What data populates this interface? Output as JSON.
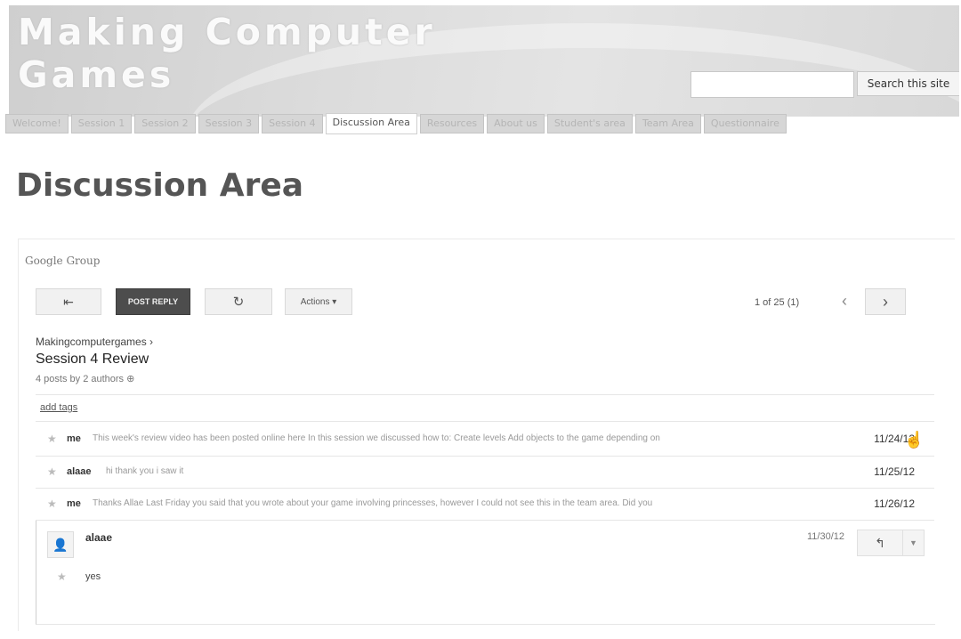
{
  "site": {
    "title_line1": "Making Computer",
    "title_line2": "Games",
    "search_button": "Search this site",
    "search_value": ""
  },
  "nav": {
    "tabs": [
      "Welcome!",
      "Session 1",
      "Session 2",
      "Session 3",
      "Session 4",
      "Discussion Area",
      "Resources",
      "About us",
      "Student's area",
      "Team Area",
      "Questionnaire"
    ],
    "active": "Discussion Area"
  },
  "page": {
    "title": "Discussion Area"
  },
  "group": {
    "label": "Google Group",
    "toolbar": {
      "back_icon": "back-arrow-icon",
      "post_reply": "POST REPLY",
      "refresh_icon": "refresh-icon",
      "actions": "Actions ▾",
      "pager": "1 of 25 (1)",
      "prev_icon": "chevron-left-icon",
      "next_icon": "chevron-right-icon"
    },
    "thread": {
      "breadcrumb": "Makingcomputergames ›",
      "title": "Session 4 Review",
      "posts_info": "4 posts by 2 authors ⊕",
      "add_tags": "add tags",
      "messages": [
        {
          "author": "me",
          "snippet": "This week's review video has been posted online here In this session we discussed how to: Create levels Add objects to the game depending on",
          "date": "11/24/12"
        },
        {
          "author": "alaae",
          "snippet": "hi   thank you i saw it",
          "date": "11/25/12"
        },
        {
          "author": "me",
          "snippet": "Thanks Allae   Last Friday you said that you wrote about your game involving princesses, however I could not see this in the team area. Did you",
          "date": "11/26/12"
        }
      ],
      "expanded": {
        "author": "alaae",
        "date": "11/30/12",
        "body": "yes"
      }
    }
  }
}
